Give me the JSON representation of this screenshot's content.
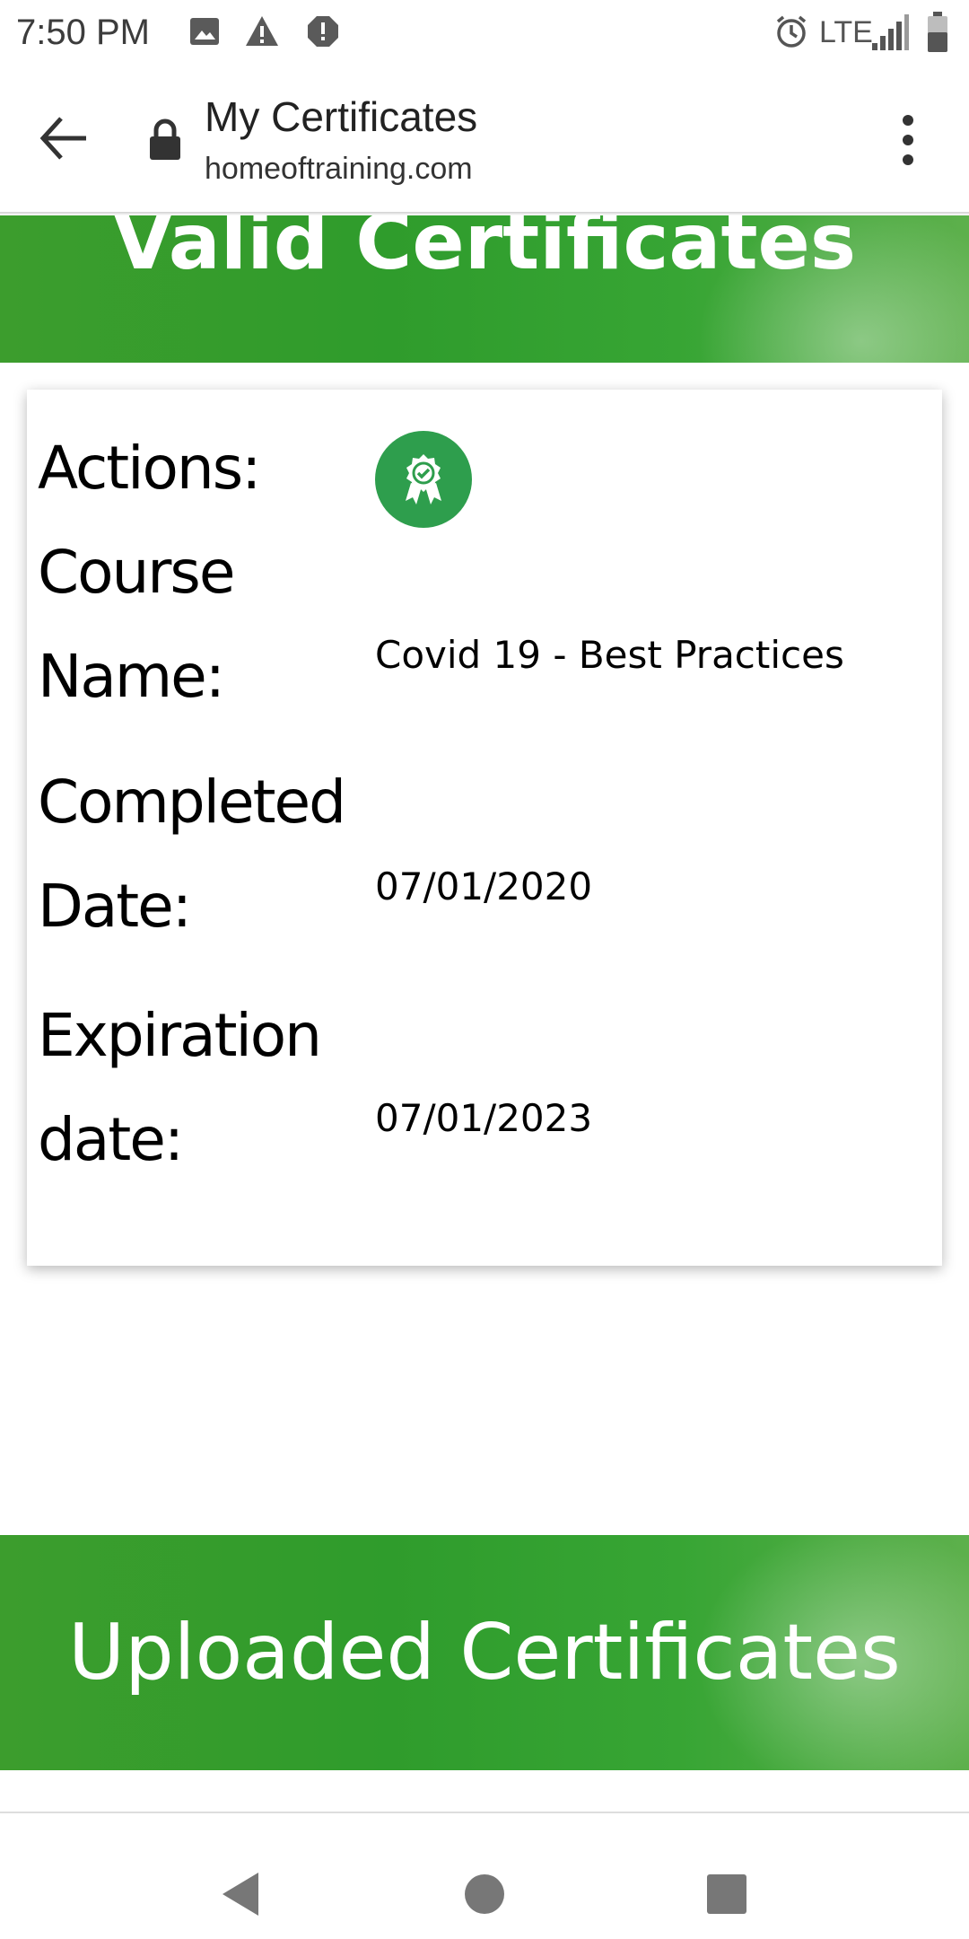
{
  "status_bar": {
    "time": "7:50 PM",
    "icons": [
      "image-icon",
      "warning-icon",
      "alert-octagon-icon",
      "alarm-icon",
      "signal-icon",
      "battery-icon"
    ],
    "network": "LTE"
  },
  "browser": {
    "page_title": "My Certificates",
    "url": "homeoftraining.com",
    "icons": [
      "back-arrow-icon",
      "lock-icon",
      "more-vert-icon"
    ]
  },
  "page": {
    "valid_banner_title": "Valid Certificates",
    "uploaded_banner_title": "Uploaded Certificates",
    "accent_color": "#2e9e4d"
  },
  "certificate": {
    "actions_label": "Actions:",
    "action_icon": "certificate-badge-icon",
    "course_name_label": "Course Name:",
    "course_name": "Covid 19 - Best Practices",
    "completed_label": "Completed Date:",
    "completed_date": "07/01/2020",
    "expiration_label": "Expiration date:",
    "expiration_date": "07/01/2023"
  },
  "nav_bar": {
    "buttons": [
      "back-triangle-icon",
      "home-circle-icon",
      "recents-square-icon"
    ]
  }
}
